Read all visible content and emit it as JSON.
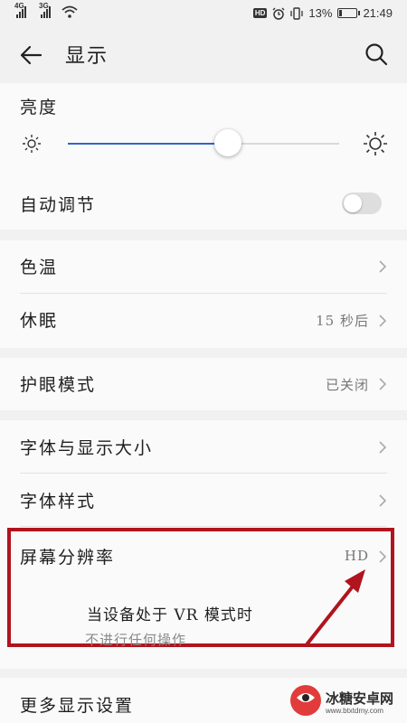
{
  "status_bar": {
    "signal1_network": "4G",
    "signal2_network": "3G",
    "hd_label": "HD",
    "battery_percent": "13%",
    "battery_level": 0.13,
    "time": "21:49"
  },
  "header": {
    "title": "显示",
    "back_icon": "arrow-left-icon",
    "search_icon": "search-icon"
  },
  "brightness": {
    "label": "亮度",
    "level": 0.59,
    "low_icon": "sun-small-icon",
    "high_icon": "sun-large-icon",
    "accent_color": "#2f66c9"
  },
  "auto_adjust": {
    "label": "自动调节",
    "enabled": false
  },
  "color_temp": {
    "label": "色温"
  },
  "sleep": {
    "label": "休眠",
    "value": "15 秒后"
  },
  "eye_comfort": {
    "label": "护眼模式",
    "value": "已关闭"
  },
  "font_size": {
    "label": "字体与显示大小"
  },
  "font_style": {
    "label": "字体样式"
  },
  "resolution": {
    "label": "屏幕分辨率",
    "value": "HD"
  },
  "annotation": {
    "main": "当设备处于 VR 模式时",
    "sub": "不进行任何操作",
    "highlight_color": "#b0141e"
  },
  "more_display": {
    "label": "更多显示设置"
  },
  "watermark": {
    "text": "冰糖安卓网",
    "url": "www.btxtdmy.com"
  }
}
